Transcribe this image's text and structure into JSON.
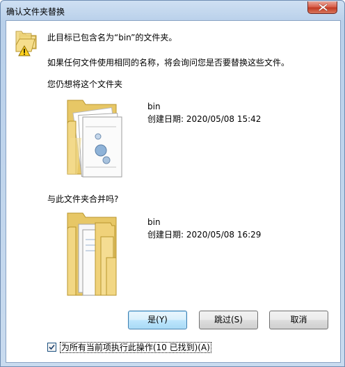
{
  "window": {
    "title": "确认文件夹替换"
  },
  "message": {
    "line1": "此目标已包含名为“bin”的文件夹。",
    "line2": "如果任何文件使用相同的名称，将会询问您是否要替换这些文件。",
    "line3": "您仍想将这个文件夹",
    "line4": "与此文件夹合并吗?"
  },
  "source_folder": {
    "name": "bin",
    "created": "创建日期: 2020/05/08 15:42"
  },
  "dest_folder": {
    "name": "bin",
    "created": "创建日期: 2020/05/08 16:29"
  },
  "buttons": {
    "yes": "是(Y)",
    "skip": "跳过(S)",
    "cancel": "取消"
  },
  "checkbox": {
    "checked": true,
    "label": "为所有当前项执行此操作(10 已找到)(A)"
  },
  "colors": {
    "title_gradient_top": "#cfe0f3",
    "close_red": "#c13b23",
    "folder_yellow": "#f2d784",
    "default_button_blue": "#3c7fb1"
  }
}
